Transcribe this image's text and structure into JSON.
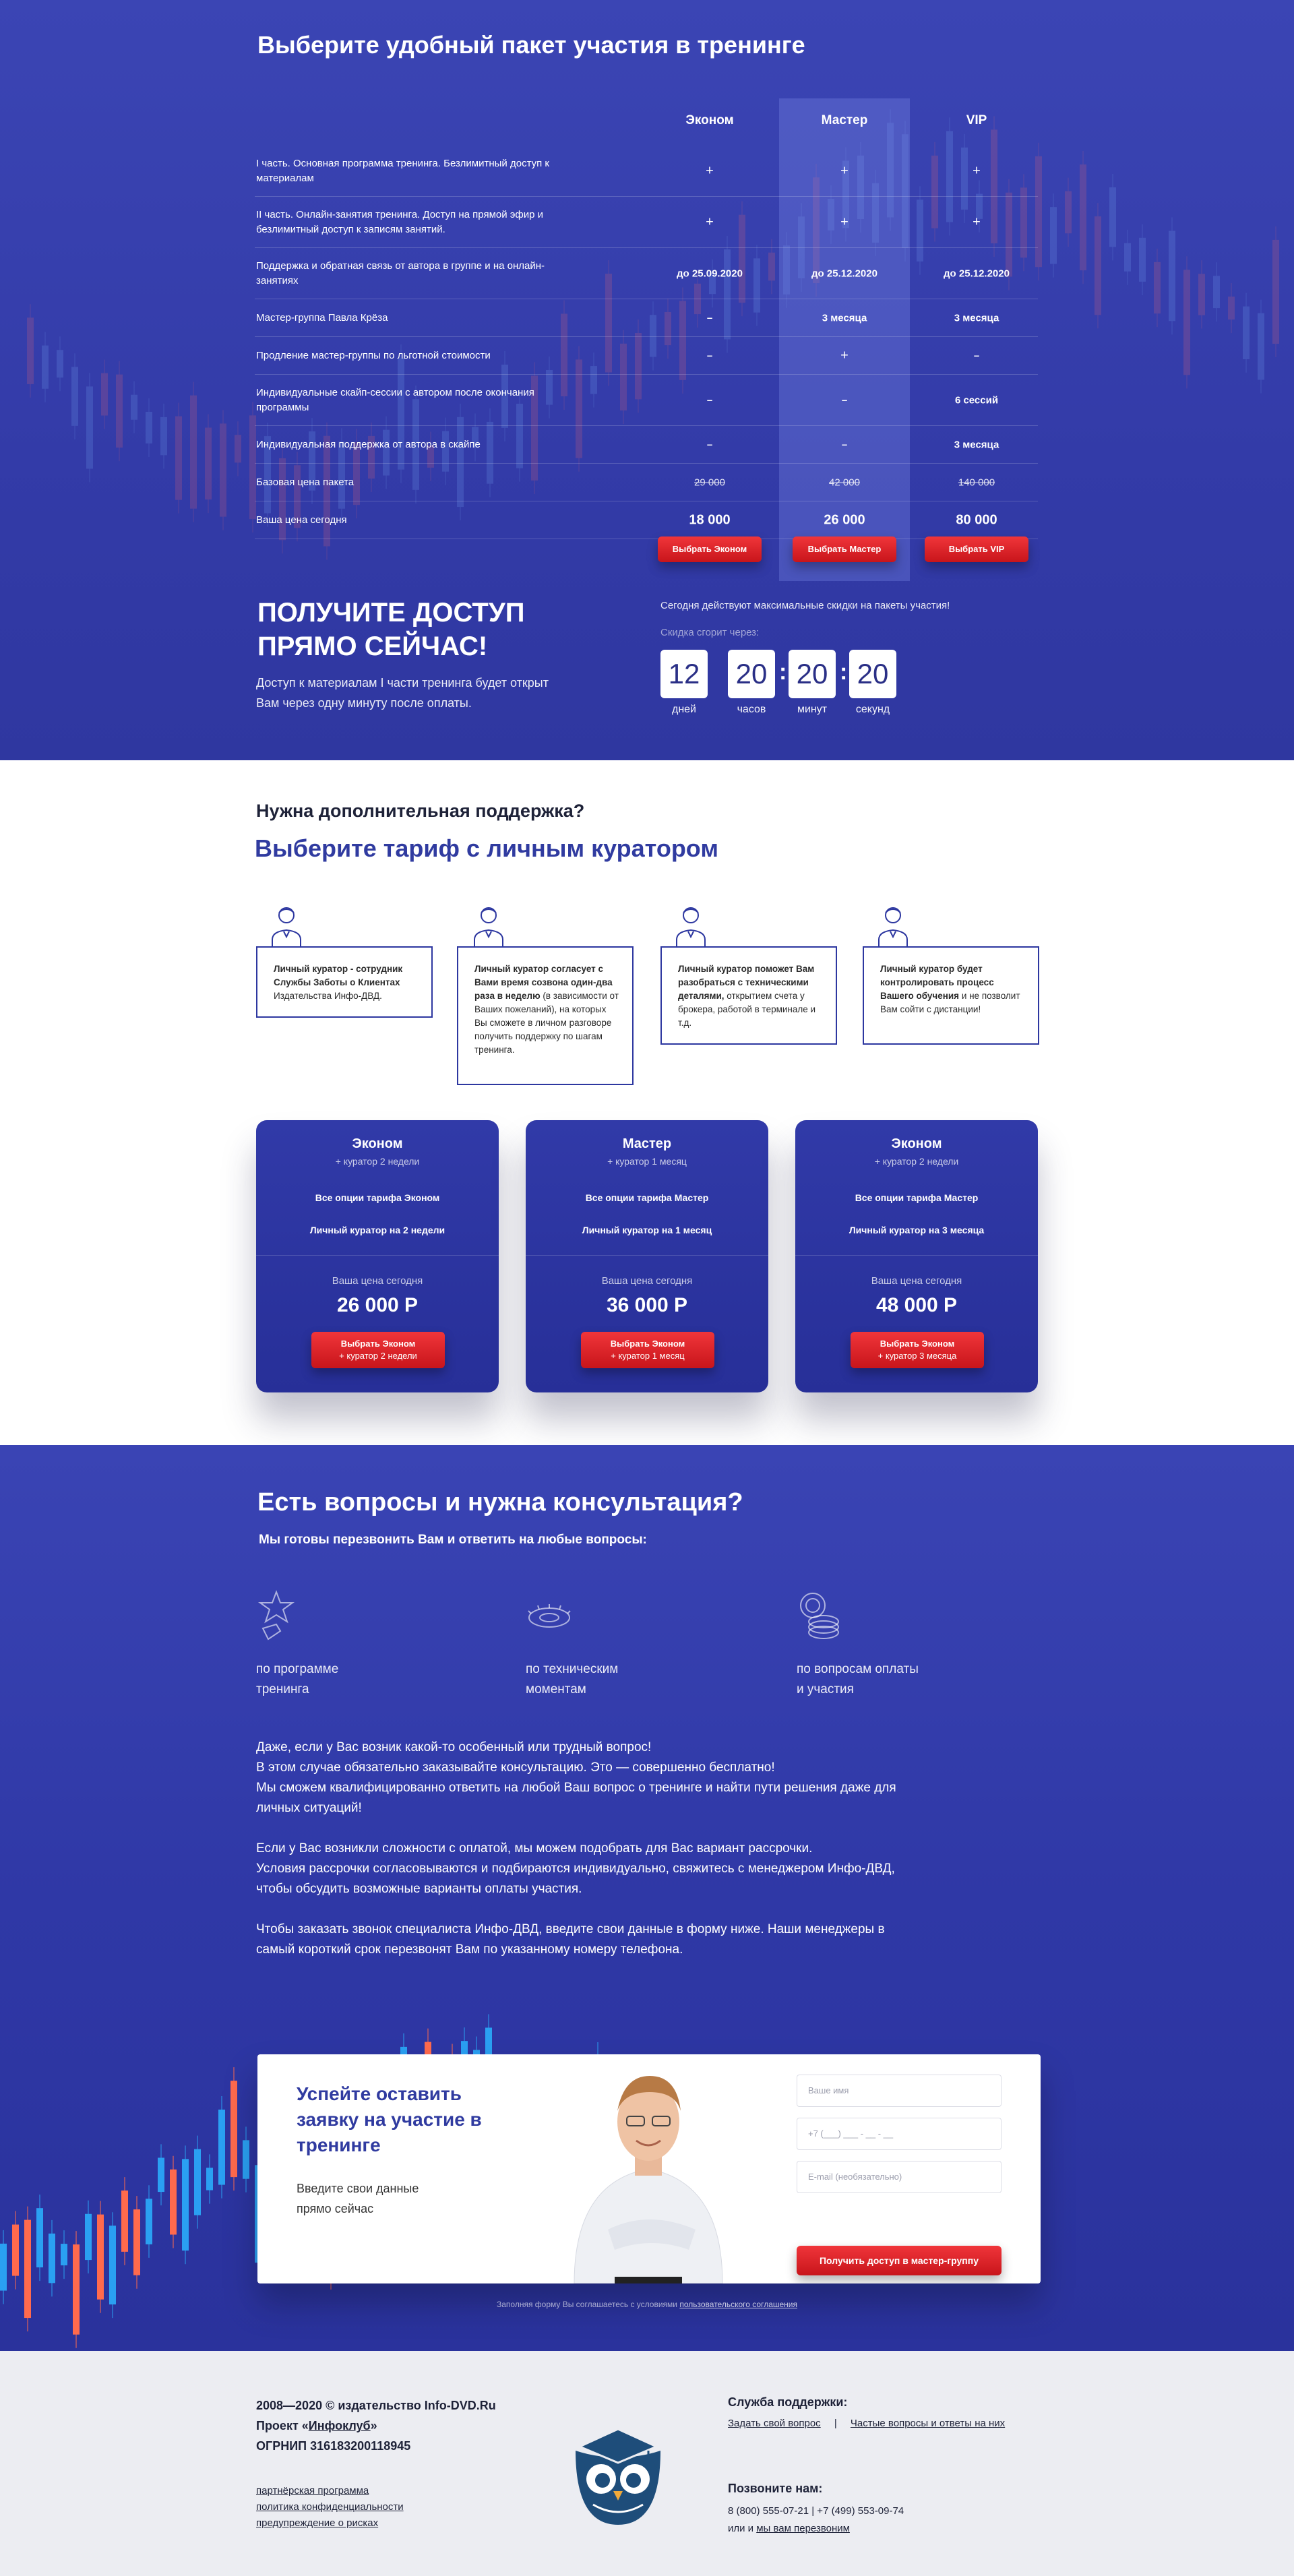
{
  "pricing": {
    "title": "Выберите удобный пакет участия в тренинге",
    "columns": [
      "Эконом",
      "Мастер",
      "VIP"
    ],
    "rows": [
      {
        "label": "I часть. Основная программа тренинга. Безлимитный доступ к материалам",
        "values": [
          "+",
          "+",
          "+"
        ]
      },
      {
        "label": "II часть. Онлайн-занятия тренинга. Доступ на прямой эфир и безлимитный доступ к записям занятий.",
        "values": [
          "+",
          "+",
          "+"
        ]
      },
      {
        "label": "Поддержка и обратная связь от автора в группе и на онлайн-занятиях",
        "values": [
          "до 25.09.2020",
          "до 25.12.2020",
          "до 25.12.2020"
        ]
      },
      {
        "label": "Мастер-группа Павла Крёза",
        "values": [
          "–",
          "3 месяца",
          "3 месяца"
        ]
      },
      {
        "label": "Продление мастер-группы по льготной стоимости",
        "values": [
          "–",
          "+",
          "–"
        ]
      },
      {
        "label": "Индивидуальные скайп-сессии с автором после окончания программы",
        "values": [
          "–",
          "–",
          "6 сессий"
        ]
      },
      {
        "label": "Индивидуальная поддержка от автора в скайпе",
        "values": [
          "–",
          "–",
          "3 месяца"
        ]
      },
      {
        "label": "Базовая цена пакета",
        "values": [
          "29 000",
          "42 000",
          "140 000"
        ]
      },
      {
        "label": "Ваша цена сегодня",
        "values": [
          "18 000",
          "26 000",
          "80 000"
        ]
      }
    ],
    "buttons": [
      "Выбрать Эконом",
      "Выбрать Мастер",
      "Выбрать VIP"
    ]
  },
  "access": {
    "title_line1": "Получите доступ",
    "title_line2": "прямо сейчас!",
    "text_line1": "Доступ к материалам I части тренинга будет открыт",
    "text_line2": "Вам через одну минуту после оплаты.",
    "discount_text": "Сегодня действуют максимальные скидки на пакеты участия!",
    "burn_text": "Скидка сгорит через:",
    "timer": [
      {
        "value": "12",
        "label": "дней"
      },
      {
        "value": "20",
        "label": "часов"
      },
      {
        "value": "20",
        "label": "минут"
      },
      {
        "value": "20",
        "label": "секунд"
      }
    ]
  },
  "curator": {
    "subtitle": "Нужна дополнительная поддержка?",
    "title": "Выберите тариф с личным куратором",
    "boxes": [
      {
        "bold": "Личный куратор - сотрудник Службы Заботы о Клиентах",
        "rest": " Издательства Инфо-ДВД."
      },
      {
        "bold": "Личный куратор согласует с Вами время созвона один-два раза в неделю",
        "rest": " (в зависимости от Ваших пожеланий), на которых Вы сможете в личном разговоре получить поддержку по шагам тренинга."
      },
      {
        "bold": "Личный куратор поможет Вам разобраться с техническими деталями,",
        "rest": " открытием счета у брокера, работой в терминале и т.д."
      },
      {
        "bold": "Личный куратор будет контролировать процесс Вашего обучения",
        "rest": " и не позволит Вам сойти с дистанции!"
      }
    ],
    "cards": [
      {
        "name": "Эконом",
        "sub": "+ куратор 2 недели",
        "opt1": "Все опции тарифа Эконом",
        "opt2": "Личный куратор на 2 недели",
        "price_label": "Ваша цена сегодня",
        "price": "26 000 Р",
        "btn": "Выбрать Эконом",
        "btn_sub": "+ куратор 2 недели"
      },
      {
        "name": "Мастер",
        "sub": "+ куратор 1 месяц",
        "opt1": "Все опции тарифа Мастер",
        "opt2": "Личный куратор на 1 месяц",
        "price_label": "Ваша цена сегодня",
        "price": "36 000 Р",
        "btn": "Выбрать Эконом",
        "btn_sub": "+ куратор 1 месяц"
      },
      {
        "name": "Эконом",
        "sub": "+ куратор 2 недели",
        "opt1": "Все опции тарифа Мастер",
        "opt2": "Личный куратор на 3 месяца",
        "price_label": "Ваша цена сегодня",
        "price": "48 000 Р",
        "btn": "Выбрать Эконом",
        "btn_sub": "+ куратор 3 месяца"
      }
    ]
  },
  "consult": {
    "title": "Есть вопросы и нужна консультация?",
    "subtitle": "Мы готовы перезвонить Вам и ответить на любые вопросы:",
    "topics": [
      {
        "line1": "по программе",
        "line2": "тренинга"
      },
      {
        "line1": "по техническим",
        "line2": "моментам"
      },
      {
        "line1": "по вопросам оплаты",
        "line2": "и участия"
      }
    ],
    "p1": [
      "Даже, если у Вас возник какой-то особенный или трудный вопрос!",
      "В этом случае обязательно заказывайте консультацию. Это — совершенно бесплатно!",
      "Мы сможем квалифицированно ответить на любой Ваш вопрос о тренинге и найти пути решения даже для",
      "личных ситуаций!"
    ],
    "p2": [
      "Если у Вас возникли сложности с оплатой, мы можем подобрать для Вас вариант рассрочки.",
      "Условия рассрочки согласовываются и подбираются индивидуально, свяжитесь с менеджером Инфо-ДВД,",
      "чтобы обсудить возможные варианты оплаты участия."
    ],
    "p3": [
      "Чтобы заказать звонок специалиста Инфо-ДВД, введите свои данные в форму ниже. Наши менеджеры в",
      "самый короткий срок перезвонят Вам по указанному номеру телефона."
    ]
  },
  "form": {
    "title_line1": "Успейте оставить",
    "title_line2": "заявку на участие в",
    "title_line3": "тренинге",
    "text_line1": "Введите свои данные",
    "text_line2": "прямо сейчас",
    "name_placeholder": "Ваше имя",
    "phone_placeholder": "+7 (___) ___ - __ - __",
    "email_placeholder": "E-mail (необязательно)",
    "submit": "Получить доступ в мастер-группу",
    "agree_text": "Заполняя форму Вы соглашаетесь с условиями ",
    "agree_link": "пользовательского соглашения"
  },
  "footer": {
    "copyright": "2008—2020 © издательство Info-DVD.Ru",
    "project_prefix": "Проект «",
    "project_link": "Инфоклуб",
    "project_suffix": "»",
    "ogrnip": "ОГРНИП 316183200118945",
    "links": [
      "партнёрская программа",
      "политика конфиденциальности",
      "предупреждение о рисках"
    ],
    "support_title": "Служба поддержки:",
    "support_link1": "Задать свой вопрос",
    "support_sep": "|",
    "support_link2": "Частые вопросы и ответы на них",
    "call_title": "Позвоните нам:",
    "phones": "8 (800) 555-07-21 | +7 (499) 553-09-74",
    "callback_prefix": "или и ",
    "callback_link": "мы вам перезвоним"
  },
  "colors": {
    "accent_blue": "#303ba0",
    "red_button": "#e0262c",
    "footer_bg": "#ecedf2"
  }
}
